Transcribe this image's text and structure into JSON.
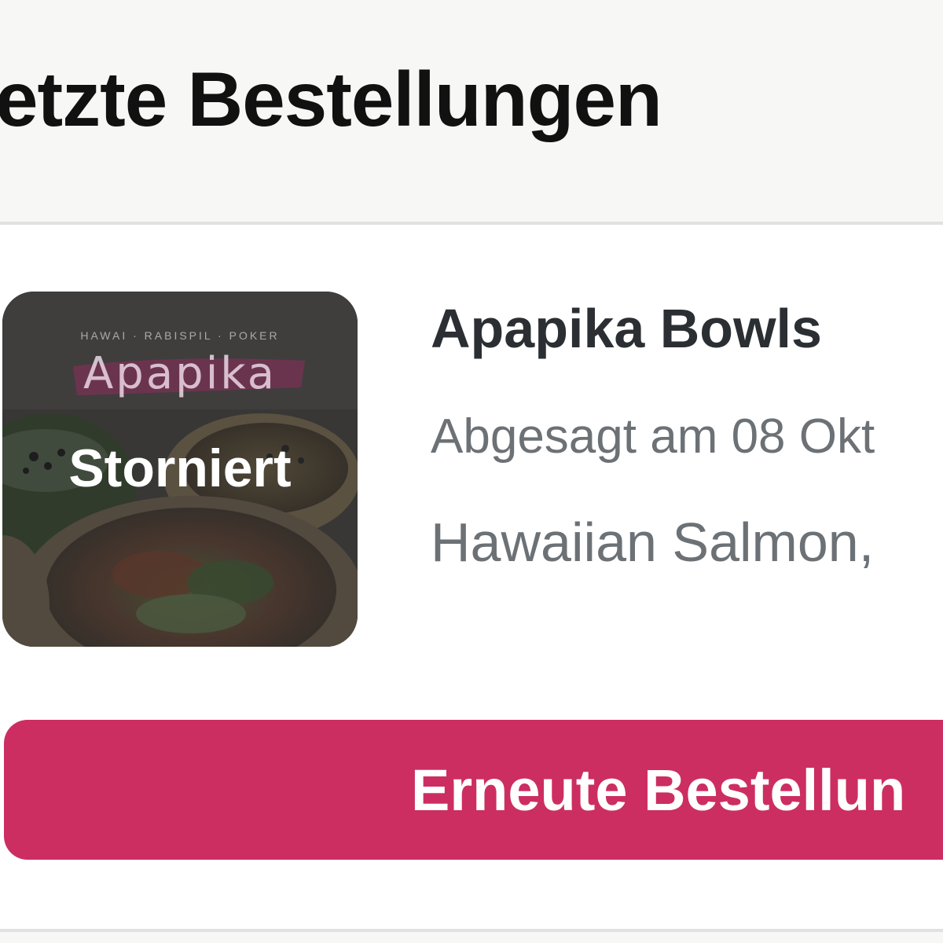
{
  "section": {
    "title": "etzte Bestellungen"
  },
  "order": {
    "thumbnail": {
      "tagline": "HAWAI · RABISPIL · POKER",
      "brand": "Apapika",
      "status_badge": "Storniert",
      "icon": "restaurant-photo"
    },
    "restaurant_name": "Apapika Bowls",
    "status_date": "Abgesagt am 08 Okt",
    "items": "Hawaiian Salmon,"
  },
  "reorder_button": {
    "label": "Erneute Bestellun"
  },
  "colors": {
    "accent": "#cc2e62",
    "header_bg": "#f7f7f5",
    "title": "#111111",
    "name": "#2b2f33",
    "secondary_text": "#6c7176",
    "divider": "#e1e1e1"
  }
}
